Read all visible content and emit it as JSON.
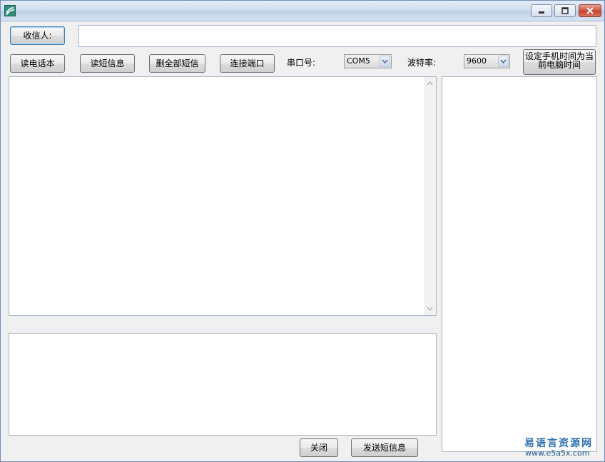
{
  "titlebar": {
    "icons": {
      "app": "app-icon",
      "minimize": "minimize-icon",
      "maximize": "maximize-icon",
      "close": "close-icon"
    }
  },
  "recipient": {
    "button_label": "收信人:",
    "value": ""
  },
  "toolbar": {
    "read_phonebook": "读电话本",
    "read_sms": "读短信息",
    "delete_all_sms": "删全部短信",
    "connect_port": "连接端口",
    "port_label": "串口号:",
    "port_value": "COM5",
    "baud_label": "波特率:",
    "baud_value": "9600",
    "set_time_line1": "设定手机时间为当",
    "set_time_line2": "前电脑时间"
  },
  "message_list": {
    "value": ""
  },
  "compose": {
    "value": ""
  },
  "side_panel": {
    "value": ""
  },
  "actions": {
    "close": "关闭",
    "send_sms": "发送短信息"
  },
  "watermark": {
    "cn": "易语言资源网",
    "url": "www.e5a5x.com"
  }
}
